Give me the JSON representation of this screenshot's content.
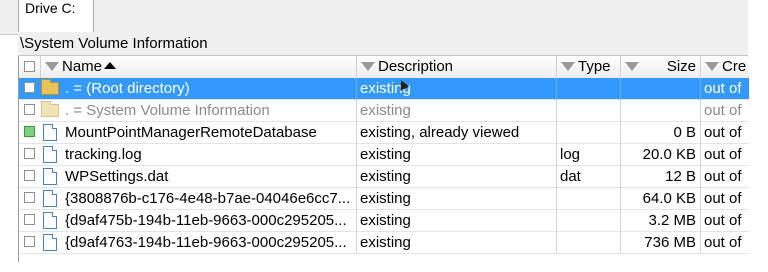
{
  "tab": {
    "label": "Drive C:"
  },
  "path": "\\System Volume Information",
  "columns": {
    "name": "Name",
    "description": "Description",
    "type": "Type",
    "size": "Size",
    "created": "Cre"
  },
  "rows": [
    {
      "name": ".    =  (Root directory)",
      "description": "existing",
      "type": "",
      "size": "",
      "created": "out of",
      "icon": "folder-icon",
      "state": "selected"
    },
    {
      "name": ".    =  System Volume Information",
      "description": "existing",
      "type": "",
      "size": "",
      "created": "out of",
      "icon": "folder-icon",
      "state": "dim"
    },
    {
      "name": "MountPointManagerRemoteDatabase",
      "description": "existing, already viewed",
      "type": "",
      "size": "0 B",
      "created": "out of",
      "icon": "file-icon",
      "state": "normal"
    },
    {
      "name": "tracking.log",
      "description": "existing",
      "type": "log",
      "size": "20.0 KB",
      "created": "out of",
      "icon": "file-icon",
      "state": "normal"
    },
    {
      "name": "WPSettings.dat",
      "description": "existing",
      "type": "dat",
      "size": "12 B",
      "created": "out of",
      "icon": "file-icon",
      "state": "normal"
    },
    {
      "name": "{3808876b-c176-4e48-b7ae-04046e6cc7...",
      "description": "existing",
      "type": "",
      "size": "64.0 KB",
      "created": "out of",
      "icon": "file-icon",
      "state": "normal"
    },
    {
      "name": "{d9af475b-194b-11eb-9663-000c295205...",
      "description": "existing",
      "type": "",
      "size": "3.2 MB",
      "created": "out of",
      "icon": "file-icon",
      "state": "normal"
    },
    {
      "name": "{d9af4763-194b-11eb-9663-000c295205...",
      "description": "existing",
      "type": "",
      "size": "736 MB",
      "created": "out of",
      "icon": "file-icon",
      "state": "normal"
    }
  ],
  "colors": {
    "selection": "#3399ff",
    "dim_text": "#8a8a8a"
  }
}
